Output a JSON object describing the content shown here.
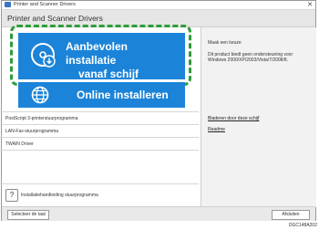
{
  "window": {
    "title": "Printer and Scanner Drivers",
    "header": "Printer and Scanner Drivers",
    "close_glyph": "✕"
  },
  "main_buttons": {
    "recommended_line1": "Aanbevolen installatie",
    "recommended_line2": "vanaf schijf",
    "online": "Online installeren"
  },
  "options": [
    "PostScript 3-printerstuurprogramma",
    "LAN-Fax-stuurprogramma",
    "TWAIN Driver"
  ],
  "help": {
    "icon_glyph": "?",
    "text": "Installatiehandleiding stuurprogramma"
  },
  "right_panel": {
    "title": "Maak een keuze",
    "line1": "Dit product biedt geen ondersteuning voor",
    "line2": "Windows 2000/XP/2003/Vista/7/2008/8.",
    "browse_link": "Bladeren door deze schijf",
    "readme_link": "Readme"
  },
  "footer": {
    "language_button": "Selecteer de taal",
    "cancel_button": "Afsluiten"
  },
  "image_code": "DGC148A202",
  "colors": {
    "button_blue": "#1c84d8",
    "highlight_green": "#2d9d3a"
  }
}
